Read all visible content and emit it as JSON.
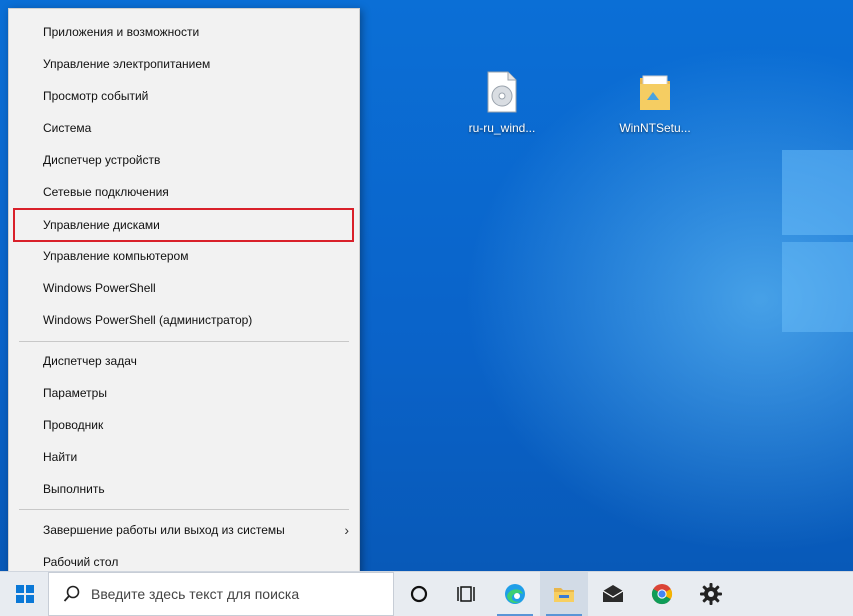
{
  "desktop": {
    "icons": [
      {
        "label": "ru-ru_wind...",
        "icon": "disc-image-icon"
      },
      {
        "label": "WinNTSetu...",
        "icon": "folder-icon"
      }
    ]
  },
  "context_menu": {
    "items": [
      "Приложения и возможности",
      "Управление электропитанием",
      "Просмотр событий",
      "Система",
      "Диспетчер устройств",
      "Сетевые подключения",
      "Управление дисками",
      "Управление компьютером",
      "Windows PowerShell",
      "Windows PowerShell (администратор)",
      "Диспетчер задач",
      "Параметры",
      "Проводник",
      "Найти",
      "Выполнить",
      "Завершение работы или выход из системы",
      "Рабочий стол"
    ],
    "highlighted_item": "Управление дисками",
    "highlight_color": "#d9202a"
  },
  "taskbar": {
    "search_placeholder": "Введите здесь текст для поиска",
    "apps": [
      "cortana-icon",
      "task-view-icon",
      "edge-icon",
      "file-explorer-icon",
      "mail-icon",
      "chrome-icon",
      "settings-icon"
    ]
  }
}
